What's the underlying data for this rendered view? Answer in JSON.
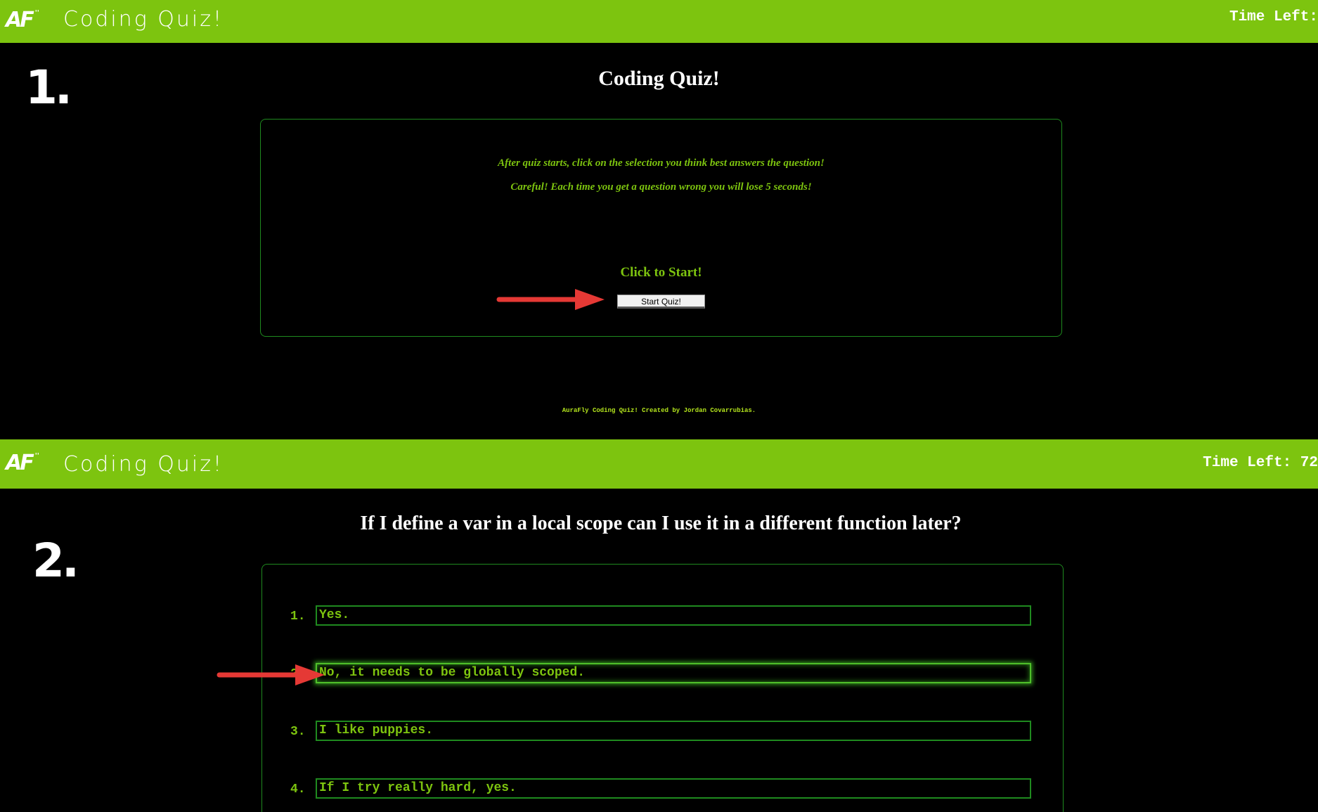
{
  "screen1": {
    "header": {
      "logo_text": "AF",
      "logo_mark": "''",
      "title": "Coding Quiz!",
      "timer": "Time Left:"
    },
    "step_label": "1.",
    "heading": "Coding Quiz!",
    "instructions": [
      "After quiz starts, click on the selection you think best answers the question!",
      "Careful! Each time you get a question wrong you will lose 5 seconds!"
    ],
    "start_prompt": "Click to Start!",
    "start_button_label": "Start Quiz!",
    "footer": "AuraFly Coding Quiz! Created by Jordan Covarrubias."
  },
  "screen2": {
    "header": {
      "logo_text": "AF",
      "logo_mark": "''",
      "title": "Coding Quiz!",
      "timer": "Time Left: 72"
    },
    "step_label": "2.",
    "question": "If I define a var in a local scope can I use it in a different function later?",
    "answers": [
      {
        "num": "1.",
        "text": "Yes."
      },
      {
        "num": "2.",
        "text": "No, it needs to be globally scoped."
      },
      {
        "num": "3.",
        "text": "I like puppies."
      },
      {
        "num": "4.",
        "text": "If I try really hard, yes."
      }
    ]
  },
  "colors": {
    "header_bg": "#7dc40f",
    "accent_green": "#7dc40f",
    "box_border": "#1f8a1f",
    "background": "#000000",
    "arrow_red": "#e53935"
  },
  "icons": [
    "arrow-right-icon",
    "af-logo"
  ]
}
